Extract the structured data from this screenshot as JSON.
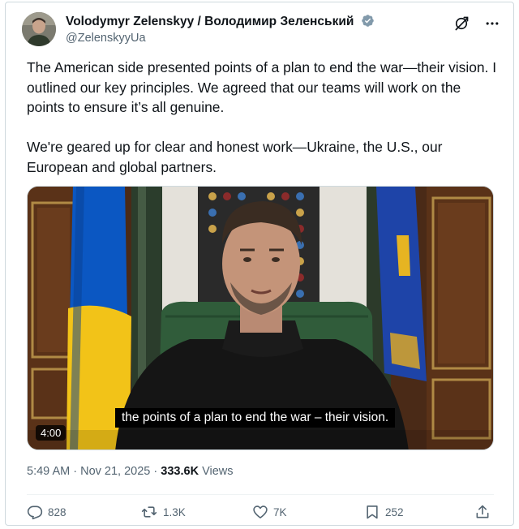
{
  "author": {
    "display_name": "Volodymyr Zelenskyy / Володимир Зеленський",
    "handle": "@ZelenskyyUa"
  },
  "tweet": {
    "paragraphs": [
      "The American side presented points of a plan to end the war—their vision. I outlined our key principles. We agreed that our teams will work on the points to ensure it’s all genuine.",
      "We're geared up for clear and honest work—Ukraine, the U.S., our European and global partners."
    ]
  },
  "video": {
    "duration": "4:00",
    "caption": "the points of a plan to end the war – their vision."
  },
  "meta": {
    "time": "5:49 AM",
    "separator": "·",
    "date": "Nov 21, 2025",
    "views_count": "333.6K",
    "views_label": "Views"
  },
  "actions": {
    "replies": "828",
    "reposts": "1.3K",
    "likes": "7K",
    "bookmarks": "252"
  },
  "icons": [
    "verified-badge-icon",
    "grok-icon",
    "more-icon",
    "reply-icon",
    "repost-icon",
    "like-icon",
    "bookmark-icon",
    "share-icon"
  ],
  "colors": {
    "verified": "#829aab",
    "text": "#0f1419",
    "secondary": "#536471",
    "border": "#cfd9de"
  }
}
